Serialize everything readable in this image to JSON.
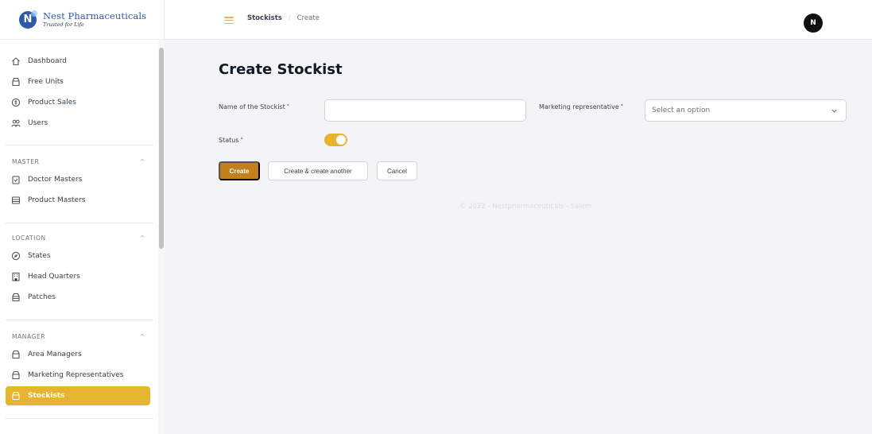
{
  "brand": {
    "name": "Nest Pharmaceuticals",
    "tagline": "Trusted for Life",
    "logo_letter": "N"
  },
  "sidebar": {
    "top_items": [
      {
        "label": "Dashboard",
        "icon": "home-icon"
      },
      {
        "label": "Free Units",
        "icon": "box-icon"
      },
      {
        "label": "Product Sales",
        "icon": "coin-icon"
      },
      {
        "label": "Users",
        "icon": "users-icon"
      }
    ],
    "sections": [
      {
        "title": "MASTER",
        "items": [
          {
            "label": "Doctor Masters",
            "icon": "clipboard-icon"
          },
          {
            "label": "Product Masters",
            "icon": "table-icon"
          }
        ]
      },
      {
        "title": "LOCATION",
        "items": [
          {
            "label": "States",
            "icon": "compass-icon"
          },
          {
            "label": "Head Quarters",
            "icon": "building-icon"
          },
          {
            "label": "Patches",
            "icon": "box-icon"
          }
        ]
      },
      {
        "title": "MANAGER",
        "items": [
          {
            "label": "Area Managers",
            "icon": "box-icon"
          },
          {
            "label": "Marketing Representatives",
            "icon": "box-icon"
          },
          {
            "label": "Stockists",
            "icon": "box-icon",
            "active": true
          }
        ]
      }
    ],
    "collapse_glyph": "^"
  },
  "header": {
    "breadcrumb": [
      "Stockists",
      "Create"
    ],
    "breadcrumb_separator": "/",
    "avatar_initial": "N"
  },
  "form": {
    "title": "Create Stockist",
    "name_label": "Name of the Stockist",
    "name_value": "",
    "rep_label": "Marketing representative",
    "rep_placeholder": "Select an option",
    "status_label": "Status",
    "status_on": true,
    "required_mark": "*"
  },
  "actions": {
    "create": "Create",
    "create_another": "Create & create another",
    "cancel": "Cancel"
  },
  "footer": {
    "text": "© 2022 - Nestpharmaceuticals - Salem"
  },
  "colors": {
    "accent": "#e6b42f",
    "primary_button": "#c27f1c",
    "brand_blue": "#2f5aa8"
  }
}
